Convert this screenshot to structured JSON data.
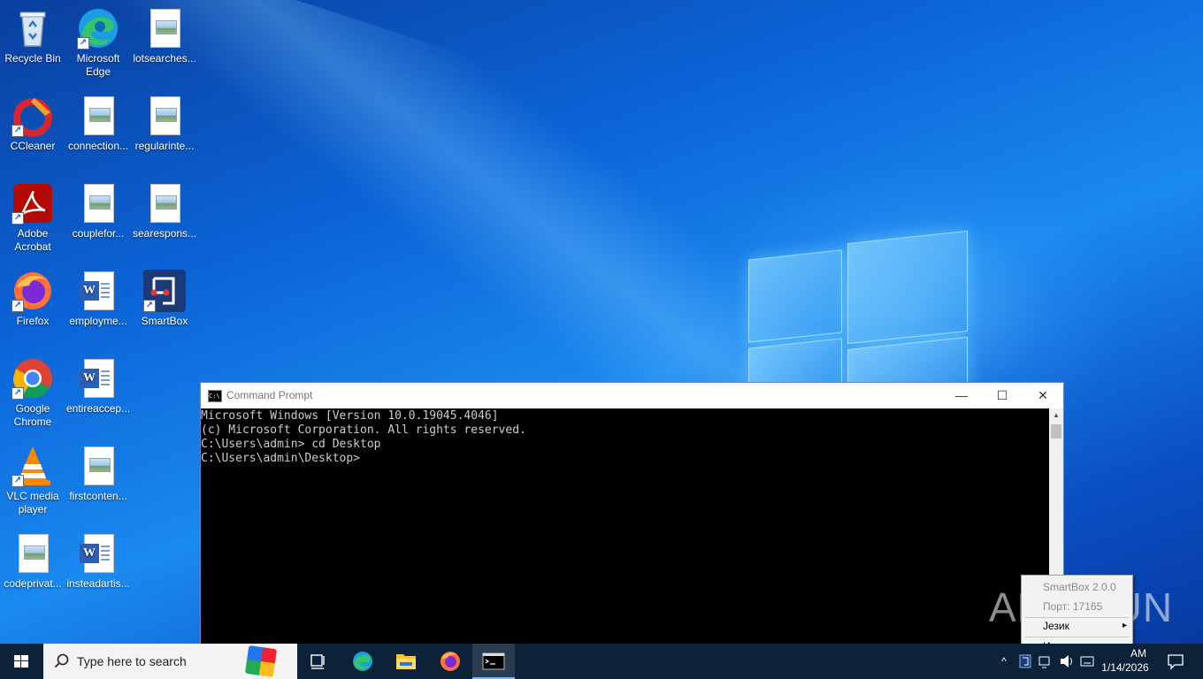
{
  "desktop": {
    "icons": [
      {
        "label": "Recycle Bin"
      },
      {
        "label": "Microsoft Edge"
      },
      {
        "label": "lotsearches..."
      },
      {
        "label": "CCleaner"
      },
      {
        "label": "connection..."
      },
      {
        "label": "regularinte..."
      },
      {
        "label": "Adobe Acrobat"
      },
      {
        "label": "couplefor..."
      },
      {
        "label": "searespons..."
      },
      {
        "label": "Firefox"
      },
      {
        "label": "employme..."
      },
      {
        "label": "SmartBox"
      },
      {
        "label": "Google Chrome"
      },
      {
        "label": "entireaccep..."
      },
      {
        "label": "VLC media player"
      },
      {
        "label": "firstconten..."
      },
      {
        "label": "codeprivat..."
      },
      {
        "label": "insteadartis..."
      }
    ]
  },
  "cmd_window": {
    "title": "Command Prompt",
    "icon_text": "C:\\",
    "lines": [
      "Microsoft Windows [Version 10.0.19045.4046]",
      "(c) Microsoft Corporation. All rights reserved.",
      "",
      "C:\\Users\\admin> cd Desktop",
      "",
      "C:\\Users\\admin\\Desktop>"
    ],
    "controls": {
      "minimize": "—",
      "maximize": "☐",
      "close": "✕"
    }
  },
  "tray_menu": {
    "items": [
      {
        "label": "SmartBox 2.0.0",
        "disabled": true
      },
      {
        "label": "Порт: 17165",
        "disabled": true
      },
      {
        "label": "Језик",
        "submenu": true
      },
      {
        "label": "Излаз"
      }
    ]
  },
  "watermark": "ANY.RUN",
  "taskbar": {
    "search_placeholder": "Type here to search",
    "clock_time": "AM",
    "clock_date": "1/14/2026",
    "tray_up_arrow": "^"
  },
  "colors": {
    "taskbar": "#0c2238",
    "console_bg": "#000000",
    "console_fg": "#cccccc",
    "accent": "#1a8af0"
  }
}
